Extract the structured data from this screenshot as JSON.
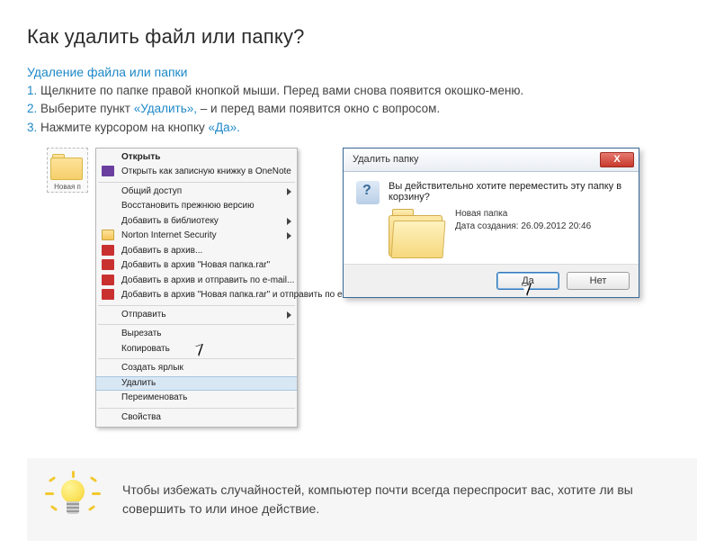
{
  "title": "Как удалить файл или папку?",
  "subhead": "Удаление файла или папки",
  "steps": {
    "s1_num": "1.",
    "s1_text": "Щелкните по папке правой кнопкой мыши. Перед вами снова появится окошко-меню.",
    "s2_num": "2.",
    "s2_a": "Выберите пункт ",
    "s2_kw": "«Удалить»,",
    "s2_b": " – и перед вами появится окно с вопросом.",
    "s3_num": "3.",
    "s3_a": "Нажмите курсором на кнопку ",
    "s3_kw": "«Да»."
  },
  "folder": {
    "label": "Новая п"
  },
  "context_menu": {
    "open": "Открыть",
    "open_onenote": "Открыть как записную книжку в OneNote",
    "share": "Общий доступ",
    "restore": "Восстановить прежнюю версию",
    "library": "Добавить в библиотеку",
    "norton": "Norton Internet Security",
    "add_archive": "Добавить в архив...",
    "add_rar": "Добавить в архив \"Новая папка.rar\"",
    "add_email": "Добавить в архив и отправить по e-mail...",
    "add_rar_email": "Добавить в архив \"Новая папка.rar\" и отправить по e-mail",
    "send": "Отправить",
    "cut": "Вырезать",
    "copy": "Копировать",
    "shortcut": "Создать ярлык",
    "delete": "Удалить",
    "rename": "Переименовать",
    "props": "Свойства"
  },
  "dialog": {
    "title": "Удалить папку",
    "close": "X",
    "message": "Вы действительно хотите переместить эту папку в корзину?",
    "folder_name": "Новая папка",
    "date_line": "Дата создания: 26.09.2012 20:46",
    "yes": "Да",
    "no": "Нет"
  },
  "tip": "Чтобы избежать случайностей, компьютер почти всегда переспросит вас, хотите ли вы совершить то или иное действие."
}
